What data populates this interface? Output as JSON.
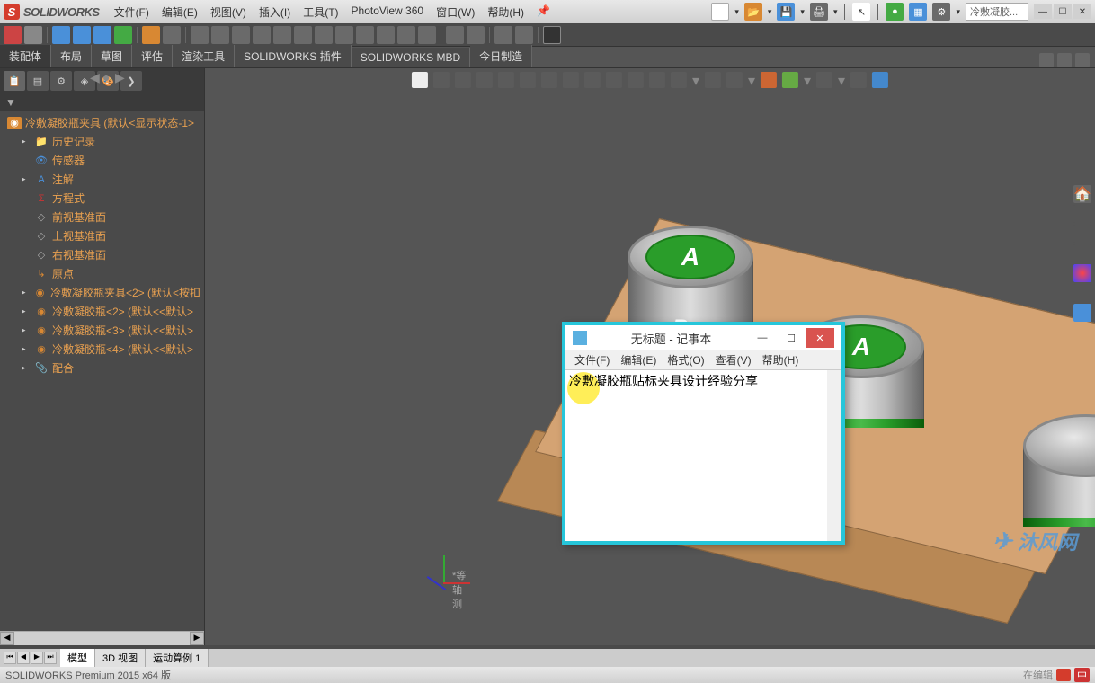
{
  "app": {
    "name": "SOLIDWORKS",
    "doc_search": "冷敷凝胶..."
  },
  "menu": {
    "file": "文件(F)",
    "edit": "编辑(E)",
    "view": "视图(V)",
    "insert": "插入(I)",
    "tools": "工具(T)",
    "photoview": "PhotoView 360",
    "window": "窗口(W)",
    "help": "帮助(H)"
  },
  "cmd_tabs": {
    "assembly": "装配体",
    "layout": "布局",
    "sketch": "草图",
    "evaluate": "评估",
    "render": "渲染工具",
    "sw_plugin": "SOLIDWORKS 插件",
    "sw_mbd": "SOLIDWORKS MBD",
    "today": "今日制造"
  },
  "tree": {
    "root": "冷敷凝胶瓶夹具 (默认<显示状态-1>",
    "history": "历史记录",
    "sensors": "传感器",
    "annotations": "注解",
    "equations": "方程式",
    "front_plane": "前视基准面",
    "top_plane": "上视基准面",
    "right_plane": "右视基准面",
    "origin": "原点",
    "part1": "冷敷凝胶瓶夹具<2> (默认<按扣",
    "part2": "冷敷凝胶瓶<2> (默认<<默认>",
    "part3": "冷敷凝胶瓶<3> (默认<<默认>",
    "part4": "冷敷凝胶瓶<4> (默认<<默认>",
    "mates": "配合"
  },
  "model": {
    "label_a": "A",
    "label_b": "B"
  },
  "triad_label": "*等轴测",
  "bottom_tabs": {
    "model": "模型",
    "view3d": "3D 视图",
    "motion": "运动算例 1"
  },
  "notepad": {
    "title": "无标题 - 记事本",
    "menu": {
      "file": "文件(F)",
      "edit": "编辑(E)",
      "format": "格式(O)",
      "view": "查看(V)",
      "help": "帮助(H)"
    },
    "content": "冷敷凝胶瓶贴标夹具设计经验分享"
  },
  "watermark": "沐风网",
  "status": {
    "version": "SOLIDWORKS Premium 2015 x64 版",
    "edit_mode": "在编辑",
    "zh": "中"
  }
}
